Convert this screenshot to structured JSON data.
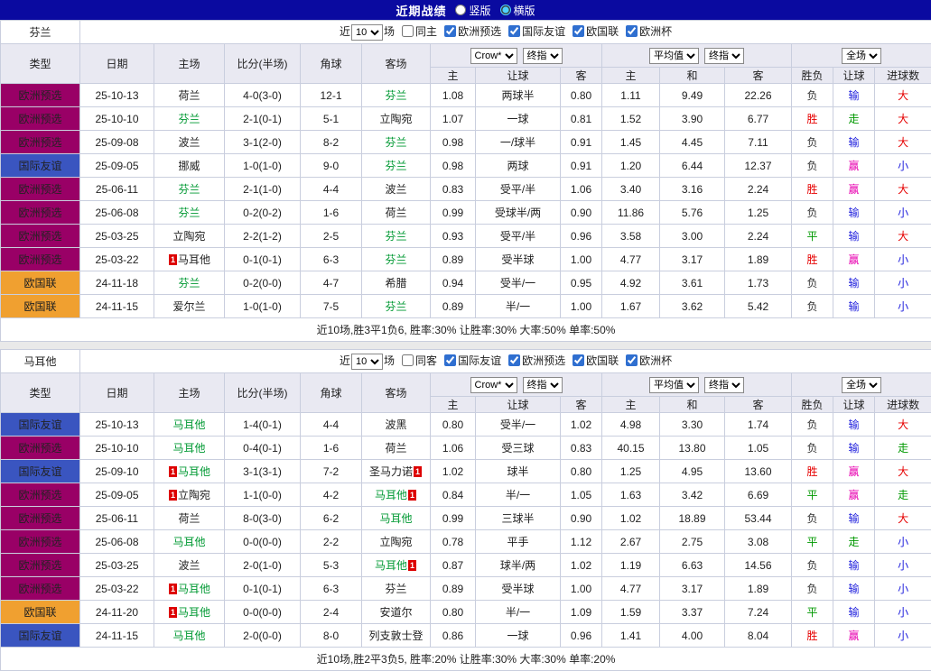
{
  "topbar": {
    "title": "近期战绩",
    "radio_vertical": "竖版",
    "radio_horizontal": "横版",
    "selected": "横版"
  },
  "filter_words": {
    "near": "近",
    "matches": "场"
  },
  "dropdowns": {
    "count": "10",
    "book": "Crow*",
    "final1": "终指",
    "avg": "平均值",
    "final2": "终指",
    "scope": "全场"
  },
  "columns": {
    "type": "类型",
    "date": "日期",
    "home": "主场",
    "score": "比分(半场)",
    "corner": "角球",
    "away": "客场",
    "odds_home": "主",
    "odds_handicap": "让球",
    "odds_away": "客",
    "avg_home": "主",
    "avg_draw": "和",
    "avg_away": "客",
    "result": "胜负",
    "handicap_result": "让球",
    "goals": "进球数"
  },
  "mark_label": "1",
  "colors": {
    "topbar_bg": "#0a0aa0",
    "header_bg": "#e9e9f2",
    "border": "#c9cede",
    "team_focus": "#009933",
    "team_other": "#222222",
    "score": "#e60000",
    "summary": "#e60000",
    "mark_bg": "#dd0000"
  },
  "type_colors": {
    "欧洲预选": "#990066",
    "国际友谊": "#3a55c0",
    "欧国联": "#f0a030"
  },
  "value_colors": {
    "胜": "#e60000",
    "平": "#009900",
    "负": "#333333",
    "赢": "#e800b0",
    "输": "#2222dd",
    "走": "#009900",
    "大": "#e60000",
    "小": "#2222dd"
  },
  "tables": [
    {
      "team": "芬兰",
      "same_label": "同主",
      "same_checked": false,
      "competitions": [
        {
          "label": "欧洲预选",
          "checked": true
        },
        {
          "label": "国际友谊",
          "checked": true
        },
        {
          "label": "欧国联",
          "checked": true
        },
        {
          "label": "欧洲杯",
          "checked": true
        }
      ],
      "rows": [
        {
          "type": "欧洲预选",
          "date": "25-10-13",
          "home": "荷兰",
          "home_green": false,
          "home_mark": "",
          "score": "4-0(3-0)",
          "corner": "12-1",
          "away": "芬兰",
          "away_green": true,
          "away_mark": "",
          "odds": [
            "1.08",
            "两球半",
            "0.80"
          ],
          "avg": [
            "1.11",
            "9.49",
            "22.26"
          ],
          "res": "负",
          "hres": "输",
          "goals": "大"
        },
        {
          "type": "欧洲预选",
          "date": "25-10-10",
          "home": "芬兰",
          "home_green": true,
          "home_mark": "",
          "score": "2-1(0-1)",
          "corner": "5-1",
          "away": "立陶宛",
          "away_green": false,
          "away_mark": "",
          "odds": [
            "1.07",
            "一球",
            "0.81"
          ],
          "avg": [
            "1.52",
            "3.90",
            "6.77"
          ],
          "res": "胜",
          "hres": "走",
          "goals": "大"
        },
        {
          "type": "欧洲预选",
          "date": "25-09-08",
          "home": "波兰",
          "home_green": false,
          "home_mark": "",
          "score": "3-1(2-0)",
          "corner": "8-2",
          "away": "芬兰",
          "away_green": true,
          "away_mark": "",
          "odds": [
            "0.98",
            "一/球半",
            "0.91"
          ],
          "avg": [
            "1.45",
            "4.45",
            "7.11"
          ],
          "res": "负",
          "hres": "输",
          "goals": "大"
        },
        {
          "type": "国际友谊",
          "date": "25-09-05",
          "home": "挪威",
          "home_green": false,
          "home_mark": "",
          "score": "1-0(1-0)",
          "corner": "9-0",
          "away": "芬兰",
          "away_green": true,
          "away_mark": "",
          "odds": [
            "0.98",
            "两球",
            "0.91"
          ],
          "avg": [
            "1.20",
            "6.44",
            "12.37"
          ],
          "res": "负",
          "hres": "赢",
          "goals": "小"
        },
        {
          "type": "欧洲预选",
          "date": "25-06-11",
          "home": "芬兰",
          "home_green": true,
          "home_mark": "",
          "score": "2-1(1-0)",
          "corner": "4-4",
          "away": "波兰",
          "away_green": false,
          "away_mark": "",
          "odds": [
            "0.83",
            "受平/半",
            "1.06"
          ],
          "avg": [
            "3.40",
            "3.16",
            "2.24"
          ],
          "res": "胜",
          "hres": "赢",
          "goals": "大"
        },
        {
          "type": "欧洲预选",
          "date": "25-06-08",
          "home": "芬兰",
          "home_green": true,
          "home_mark": "",
          "score": "0-2(0-2)",
          "corner": "1-6",
          "away": "荷兰",
          "away_green": false,
          "away_mark": "",
          "odds": [
            "0.99",
            "受球半/两",
            "0.90"
          ],
          "avg": [
            "11.86",
            "5.76",
            "1.25"
          ],
          "res": "负",
          "hres": "输",
          "goals": "小"
        },
        {
          "type": "欧洲预选",
          "date": "25-03-25",
          "home": "立陶宛",
          "home_green": false,
          "home_mark": "",
          "score": "2-2(1-2)",
          "corner": "2-5",
          "away": "芬兰",
          "away_green": true,
          "away_mark": "",
          "odds": [
            "0.93",
            "受平/半",
            "0.96"
          ],
          "avg": [
            "3.58",
            "3.00",
            "2.24"
          ],
          "res": "平",
          "hres": "输",
          "goals": "大"
        },
        {
          "type": "欧洲预选",
          "date": "25-03-22",
          "home": "马耳他",
          "home_green": false,
          "home_mark": "before",
          "score": "0-1(0-1)",
          "corner": "6-3",
          "away": "芬兰",
          "away_green": true,
          "away_mark": "",
          "odds": [
            "0.89",
            "受半球",
            "1.00"
          ],
          "avg": [
            "4.77",
            "3.17",
            "1.89"
          ],
          "res": "胜",
          "hres": "赢",
          "goals": "小"
        },
        {
          "type": "欧国联",
          "date": "24-11-18",
          "home": "芬兰",
          "home_green": true,
          "home_mark": "",
          "score": "0-2(0-0)",
          "corner": "4-7",
          "away": "希腊",
          "away_green": false,
          "away_mark": "",
          "odds": [
            "0.94",
            "受半/一",
            "0.95"
          ],
          "avg": [
            "4.92",
            "3.61",
            "1.73"
          ],
          "res": "负",
          "hres": "输",
          "goals": "小"
        },
        {
          "type": "欧国联",
          "date": "24-11-15",
          "home": "爱尔兰",
          "home_green": false,
          "home_mark": "",
          "score": "1-0(1-0)",
          "corner": "7-5",
          "away": "芬兰",
          "away_green": true,
          "away_mark": "",
          "odds": [
            "0.89",
            "半/一",
            "1.00"
          ],
          "avg": [
            "1.67",
            "3.62",
            "5.42"
          ],
          "res": "负",
          "hres": "输",
          "goals": "小"
        }
      ],
      "summary": "近10场,胜3平1负6, 胜率:30% 让胜率:30% 大率:50% 单率:50%"
    },
    {
      "team": "马耳他",
      "same_label": "同客",
      "same_checked": false,
      "competitions": [
        {
          "label": "国际友谊",
          "checked": true
        },
        {
          "label": "欧洲预选",
          "checked": true
        },
        {
          "label": "欧国联",
          "checked": true
        },
        {
          "label": "欧洲杯",
          "checked": true
        }
      ],
      "rows": [
        {
          "type": "国际友谊",
          "date": "25-10-13",
          "home": "马耳他",
          "home_green": true,
          "home_mark": "",
          "score": "1-4(0-1)",
          "corner": "4-4",
          "away": "波黑",
          "away_green": false,
          "away_mark": "",
          "odds": [
            "0.80",
            "受半/一",
            "1.02"
          ],
          "avg": [
            "4.98",
            "3.30",
            "1.74"
          ],
          "res": "负",
          "hres": "输",
          "goals": "大"
        },
        {
          "type": "欧洲预选",
          "date": "25-10-10",
          "home": "马耳他",
          "home_green": true,
          "home_mark": "",
          "score": "0-4(0-1)",
          "corner": "1-6",
          "away": "荷兰",
          "away_green": false,
          "away_mark": "",
          "odds": [
            "1.06",
            "受三球",
            "0.83"
          ],
          "avg": [
            "40.15",
            "13.80",
            "1.05"
          ],
          "res": "负",
          "hres": "输",
          "goals": "走"
        },
        {
          "type": "国际友谊",
          "date": "25-09-10",
          "home": "马耳他",
          "home_green": true,
          "home_mark": "before",
          "score": "3-1(3-1)",
          "corner": "7-2",
          "away": "圣马力诺",
          "away_green": false,
          "away_mark": "after",
          "odds": [
            "1.02",
            "球半",
            "0.80"
          ],
          "avg": [
            "1.25",
            "4.95",
            "13.60"
          ],
          "res": "胜",
          "hres": "赢",
          "goals": "大"
        },
        {
          "type": "欧洲预选",
          "date": "25-09-05",
          "home": "立陶宛",
          "home_green": false,
          "home_mark": "before",
          "score": "1-1(0-0)",
          "corner": "4-2",
          "away": "马耳他",
          "away_green": true,
          "away_mark": "after",
          "odds": [
            "0.84",
            "半/一",
            "1.05"
          ],
          "avg": [
            "1.63",
            "3.42",
            "6.69"
          ],
          "res": "平",
          "hres": "赢",
          "goals": "走"
        },
        {
          "type": "欧洲预选",
          "date": "25-06-11",
          "home": "荷兰",
          "home_green": false,
          "home_mark": "",
          "score": "8-0(3-0)",
          "corner": "6-2",
          "away": "马耳他",
          "away_green": true,
          "away_mark": "",
          "odds": [
            "0.99",
            "三球半",
            "0.90"
          ],
          "avg": [
            "1.02",
            "18.89",
            "53.44"
          ],
          "res": "负",
          "hres": "输",
          "goals": "大"
        },
        {
          "type": "欧洲预选",
          "date": "25-06-08",
          "home": "马耳他",
          "home_green": true,
          "home_mark": "",
          "score": "0-0(0-0)",
          "corner": "2-2",
          "away": "立陶宛",
          "away_green": false,
          "away_mark": "",
          "odds": [
            "0.78",
            "平手",
            "1.12"
          ],
          "avg": [
            "2.67",
            "2.75",
            "3.08"
          ],
          "res": "平",
          "hres": "走",
          "goals": "小"
        },
        {
          "type": "欧洲预选",
          "date": "25-03-25",
          "home": "波兰",
          "home_green": false,
          "home_mark": "",
          "score": "2-0(1-0)",
          "corner": "5-3",
          "away": "马耳他",
          "away_green": true,
          "away_mark": "after",
          "odds": [
            "0.87",
            "球半/两",
            "1.02"
          ],
          "avg": [
            "1.19",
            "6.63",
            "14.56"
          ],
          "res": "负",
          "hres": "输",
          "goals": "小"
        },
        {
          "type": "欧洲预选",
          "date": "25-03-22",
          "home": "马耳他",
          "home_green": true,
          "home_mark": "before",
          "score": "0-1(0-1)",
          "corner": "6-3",
          "away": "芬兰",
          "away_green": false,
          "away_mark": "",
          "odds": [
            "0.89",
            "受半球",
            "1.00"
          ],
          "avg": [
            "4.77",
            "3.17",
            "1.89"
          ],
          "res": "负",
          "hres": "输",
          "goals": "小"
        },
        {
          "type": "欧国联",
          "date": "24-11-20",
          "home": "马耳他",
          "home_green": true,
          "home_mark": "before",
          "score": "0-0(0-0)",
          "corner": "2-4",
          "away": "安道尔",
          "away_green": false,
          "away_mark": "",
          "odds": [
            "0.80",
            "半/一",
            "1.09"
          ],
          "avg": [
            "1.59",
            "3.37",
            "7.24"
          ],
          "res": "平",
          "hres": "输",
          "goals": "小"
        },
        {
          "type": "国际友谊",
          "date": "24-11-15",
          "home": "马耳他",
          "home_green": true,
          "home_mark": "",
          "score": "2-0(0-0)",
          "corner": "8-0",
          "away": "列支敦士登",
          "away_green": false,
          "away_mark": "",
          "odds": [
            "0.86",
            "一球",
            "0.96"
          ],
          "avg": [
            "1.41",
            "4.00",
            "8.04"
          ],
          "res": "胜",
          "hres": "赢",
          "goals": "小"
        }
      ],
      "summary": "近10场,胜2平3负5, 胜率:20% 让胜率:30% 大率:30% 单率:20%"
    }
  ]
}
